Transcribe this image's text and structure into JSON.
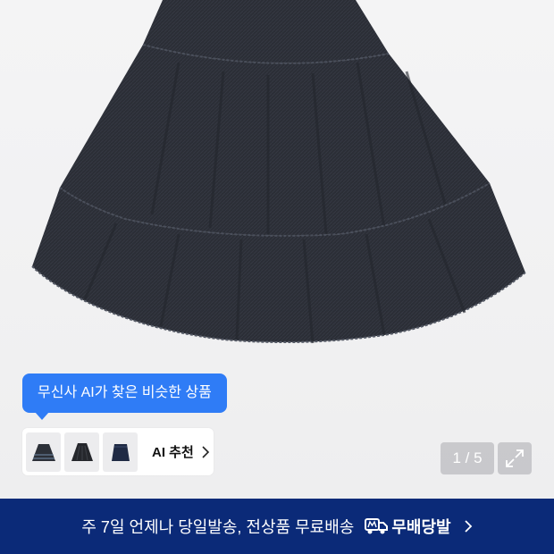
{
  "product": {
    "image_icon": "denim-tiered-skirt-image",
    "skirt_color": "#2c2f37",
    "background_color": "#f2f2f3"
  },
  "ai_recommend": {
    "tooltip_text": "무신사 AI가 찾은 비슷한 상품",
    "button_label": "AI 추천",
    "accent_color": "#2f7cf6",
    "thumbnails": [
      "similar-skirt-1",
      "similar-skirt-2",
      "similar-skirt-3"
    ]
  },
  "gallery": {
    "counter": "1 / 5",
    "current": 1,
    "total": 5,
    "expand_icon": "expand-icon"
  },
  "delivery_banner": {
    "text": "주 7일 언제나 당일발송, 전상품 무료배송",
    "brand": "무배당발",
    "brand_icon": "truck-icon",
    "background_color": "#0b2a78"
  }
}
